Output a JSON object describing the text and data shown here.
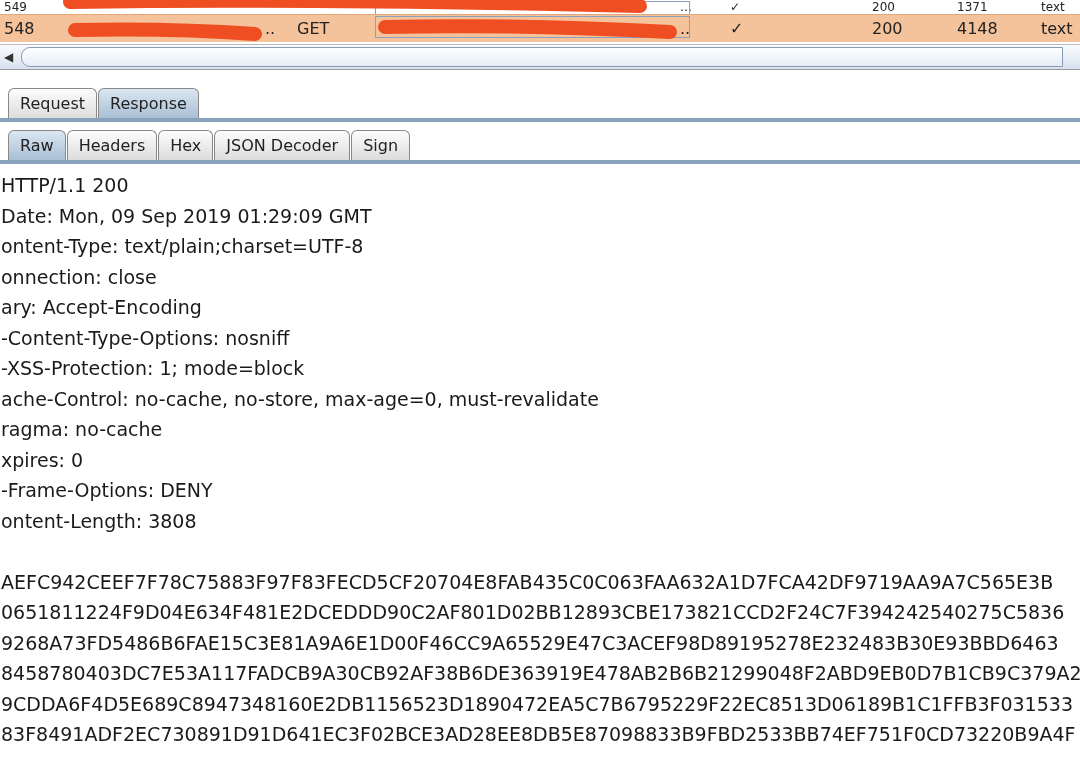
{
  "table": {
    "rows": [
      {
        "cells": [
          "549",
          null,
          null,
          "…",
          "✓",
          "200",
          "1371",
          "text"
        ],
        "selected": false
      },
      {
        "cells": [
          "548",
          "..",
          "GET",
          "..",
          "✓",
          "200",
          "4148",
          "text"
        ],
        "selected": true
      }
    ]
  },
  "scrollbar": {
    "arrow": "◀"
  },
  "tabs": [
    {
      "label": "Request",
      "selected": false
    },
    {
      "label": "Response",
      "selected": true
    }
  ],
  "subtabs": [
    {
      "label": "Raw",
      "selected": true
    },
    {
      "label": "Headers",
      "selected": false
    },
    {
      "label": "Hex",
      "selected": false
    },
    {
      "label": "JSON Decoder",
      "selected": false
    },
    {
      "label": "Sign",
      "selected": false
    }
  ],
  "response": {
    "headers": [
      "HTTP/1.1 200",
      "Date: Mon, 09 Sep 2019 01:29:09 GMT",
      "ontent-Type: text/plain;charset=UTF-8",
      "onnection: close",
      "ary: Accept-Encoding",
      "-Content-Type-Options: nosniff",
      "-XSS-Protection: 1; mode=block",
      "ache-Control: no-cache, no-store, max-age=0, must-revalidate",
      "ragma: no-cache",
      "xpires: 0",
      "-Frame-Options: DENY",
      "ontent-Length: 3808"
    ],
    "body": [
      "AEFC942CEEF7F78C75883F97F83FECD5CF20704E8FAB435C0C063FAA632A1D7FCA42DF9719AA9A7C565E3B",
      "0651811224F9D04E634F481E2DCEDDD90C2AF801D02BB12893CBE173821CCD2F24C7F394242540275C5836",
      "9268A73FD5486B6FAE15C3E81A9A6E1D00F46CC9A65529E47C3ACEF98D89195278E232483B30E93BBD6463",
      "8458780403DC7E53A117FADCB9A30CB92AF38B6DE363919E478AB2B6B21299048F2ABD9EB0D7B1CB9C379A2",
      "9CDDA6F4D5E689C8947348160E2DB1156523D1890472EA5C7B6795229F22EC8513D06189B1C1FFB3F031533",
      "83F8491ADF2EC730891D91D641EC3F02BCE3AD28EE8DB5E87098833B9FBD2533BB74EF751F0CD73220B9A4F"
    ]
  }
}
